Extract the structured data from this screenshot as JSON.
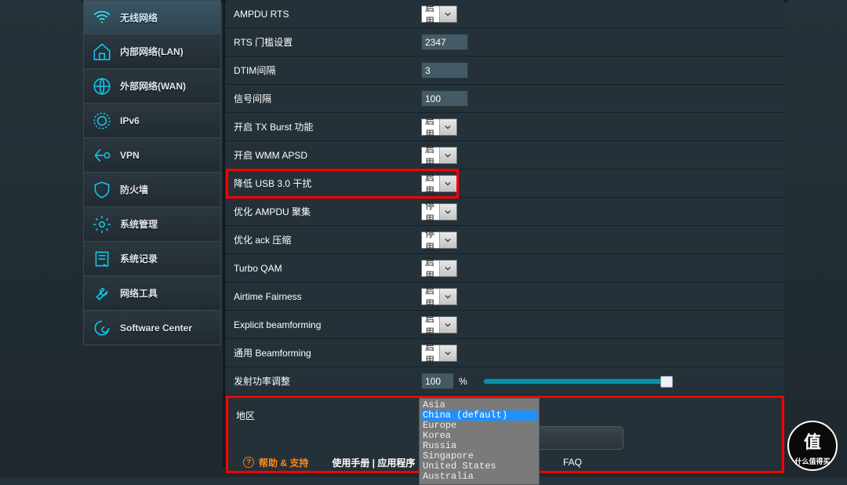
{
  "sidebar": {
    "items": [
      {
        "label": "无线网络"
      },
      {
        "label": "内部网络(LAN)"
      },
      {
        "label": "外部网络(WAN)"
      },
      {
        "label": "IPv6"
      },
      {
        "label": "VPN"
      },
      {
        "label": "防火墙"
      },
      {
        "label": "系统管理"
      },
      {
        "label": "系统记录"
      },
      {
        "label": "网络工具"
      },
      {
        "label": "Software Center"
      }
    ]
  },
  "rows": {
    "ampdu_rts": {
      "label": "AMPDU RTS",
      "value": "启用"
    },
    "rts_threshold": {
      "label": "RTS 门槛设置",
      "value": "2347"
    },
    "dtim": {
      "label": "DTIM间隔",
      "value": "3"
    },
    "beacon": {
      "label": "信号间隔",
      "value": "100"
    },
    "tx_burst": {
      "label": "开启 TX Burst 功能",
      "value": "启用"
    },
    "wmm_apsd": {
      "label": "开启 WMM APSD",
      "value": "启用"
    },
    "usb3": {
      "label": "降低 USB 3.0 干扰",
      "value": "启用"
    },
    "ampdu_agg": {
      "label": "优化 AMPDU 聚集",
      "value": "停用"
    },
    "ack": {
      "label": "优化 ack 压缩",
      "value": "停用"
    },
    "turbo_qam": {
      "label": "Turbo QAM",
      "value": "启用"
    },
    "airtime": {
      "label": "Airtime Fairness",
      "value": "启用"
    },
    "expl_bf": {
      "label": "Explicit beamforming",
      "value": "启用"
    },
    "univ_bf": {
      "label": "通用 Beamforming",
      "value": "启用"
    },
    "tx_power": {
      "label": "发射功率调整",
      "value": "100",
      "unit": "%"
    },
    "region": {
      "label": "地区"
    }
  },
  "region_options": [
    "Asia",
    "China (default)",
    "Europe",
    "Korea",
    "Russia",
    "Singapore",
    "United States",
    "Australia"
  ],
  "region_selected_index": 1,
  "footer": {
    "help": "帮助 & 支持",
    "manual": "使用手册 | 应用程序",
    "faq": "FAQ"
  },
  "watermark": "什么值得买"
}
